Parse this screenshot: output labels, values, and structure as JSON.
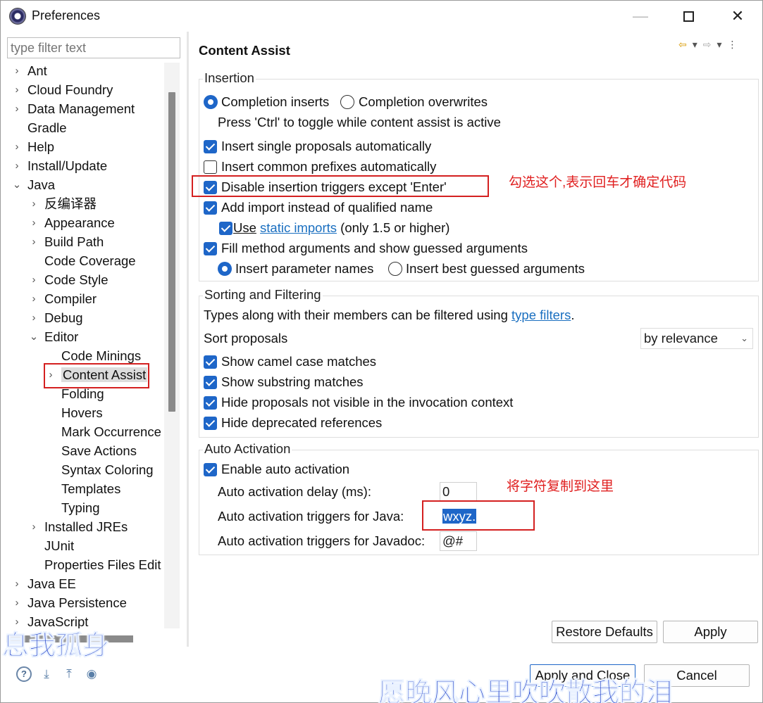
{
  "window": {
    "title": "Preferences",
    "min_glyph": "—",
    "close_glyph": "✕"
  },
  "filter": {
    "placeholder": "type filter text"
  },
  "tree": [
    {
      "label": "Ant",
      "level": 0,
      "chevron": "›"
    },
    {
      "label": "Cloud Foundry",
      "level": 0,
      "chevron": "›"
    },
    {
      "label": "Data Management",
      "level": 0,
      "chevron": "›"
    },
    {
      "label": "Gradle",
      "level": 0,
      "chevron": ""
    },
    {
      "label": "Help",
      "level": 0,
      "chevron": "›"
    },
    {
      "label": "Install/Update",
      "level": 0,
      "chevron": "›"
    },
    {
      "label": "Java",
      "level": 0,
      "chevron": "⌄"
    },
    {
      "label": "反编译器",
      "level": 1,
      "chevron": "›"
    },
    {
      "label": "Appearance",
      "level": 1,
      "chevron": "›"
    },
    {
      "label": "Build Path",
      "level": 1,
      "chevron": "›"
    },
    {
      "label": "Code Coverage",
      "level": 1,
      "chevron": ""
    },
    {
      "label": "Code Style",
      "level": 1,
      "chevron": "›"
    },
    {
      "label": "Compiler",
      "level": 1,
      "chevron": "›"
    },
    {
      "label": "Debug",
      "level": 1,
      "chevron": "›"
    },
    {
      "label": "Editor",
      "level": 1,
      "chevron": "⌄"
    },
    {
      "label": "Code Minings",
      "level": 2,
      "chevron": ""
    },
    {
      "label": "Content Assist",
      "level": 2,
      "chevron": "›",
      "selected": true
    },
    {
      "label": "Folding",
      "level": 2,
      "chevron": ""
    },
    {
      "label": "Hovers",
      "level": 2,
      "chevron": ""
    },
    {
      "label": "Mark Occurrence",
      "level": 2,
      "chevron": ""
    },
    {
      "label": "Save Actions",
      "level": 2,
      "chevron": ""
    },
    {
      "label": "Syntax Coloring",
      "level": 2,
      "chevron": ""
    },
    {
      "label": "Templates",
      "level": 2,
      "chevron": ""
    },
    {
      "label": "Typing",
      "level": 2,
      "chevron": ""
    },
    {
      "label": "Installed JREs",
      "level": 1,
      "chevron": "›"
    },
    {
      "label": "JUnit",
      "level": 1,
      "chevron": ""
    },
    {
      "label": "Properties Files Edit",
      "level": 1,
      "chevron": ""
    },
    {
      "label": "Java EE",
      "level": 0,
      "chevron": "›"
    },
    {
      "label": "Java Persistence",
      "level": 0,
      "chevron": "›"
    },
    {
      "label": "JavaScript",
      "level": 0,
      "chevron": "›"
    }
  ],
  "page": {
    "title": "Content Assist",
    "nav": {
      "back": "⇦",
      "dropdown": "▾",
      "forward": "⇨",
      "menu": "⋮"
    }
  },
  "insertion": {
    "title": "Insertion",
    "completion_inserts": "Completion inserts",
    "completion_overwrites": "Completion overwrites",
    "ctrl_hint": "Press 'Ctrl' to toggle while content assist is active",
    "single_proposals": "Insert single proposals automatically",
    "common_prefixes": "Insert common prefixes automatically",
    "disable_triggers": "Disable insertion triggers except 'Enter'",
    "add_import": "Add import instead of qualified name",
    "use_prefix": "Use",
    "static_imports": "static imports",
    "use_suffix": "(only 1.5 or higher)",
    "fill_method": "Fill method arguments and show guessed arguments",
    "param_names": "Insert parameter names",
    "best_guessed": "Insert best guessed arguments"
  },
  "sorting": {
    "title": "Sorting and Filtering",
    "types_prefix": "Types along with their members can be filtered using",
    "type_filters": "type filters",
    "types_suffix": ".",
    "sort_label": "Sort proposals",
    "sort_value": "by relevance",
    "camel_case": "Show camel case matches",
    "substring": "Show substring matches",
    "hide_not_visible": "Hide proposals not visible in the invocation context",
    "hide_deprecated": "Hide deprecated references"
  },
  "auto": {
    "title": "Auto Activation",
    "enable": "Enable auto activation",
    "delay_label": "Auto activation delay (ms):",
    "delay_value": "0",
    "java_label": "Auto activation triggers for Java:",
    "java_value": "wxyz.",
    "javadoc_label": "Auto activation triggers for Javadoc:",
    "javadoc_value": "@#"
  },
  "annotations": {
    "check_this": "勾选这个,表示回车才确定代码",
    "copy_here": "将字符复制到这里"
  },
  "buttons": {
    "restore": "Restore Defaults",
    "apply": "Apply",
    "apply_close": "Apply and Close",
    "cancel": "Cancel"
  },
  "bottom_icons": {
    "help": "?",
    "import": "⤓",
    "export": "⤒",
    "record": "◉"
  },
  "overlays": {
    "left": "息我孤身",
    "bottom": "愿晚风心里吹吹散我的泪"
  },
  "colors": {
    "accent": "#1e66c8",
    "annotation": "#e02020",
    "link": "#1a6fc0"
  }
}
